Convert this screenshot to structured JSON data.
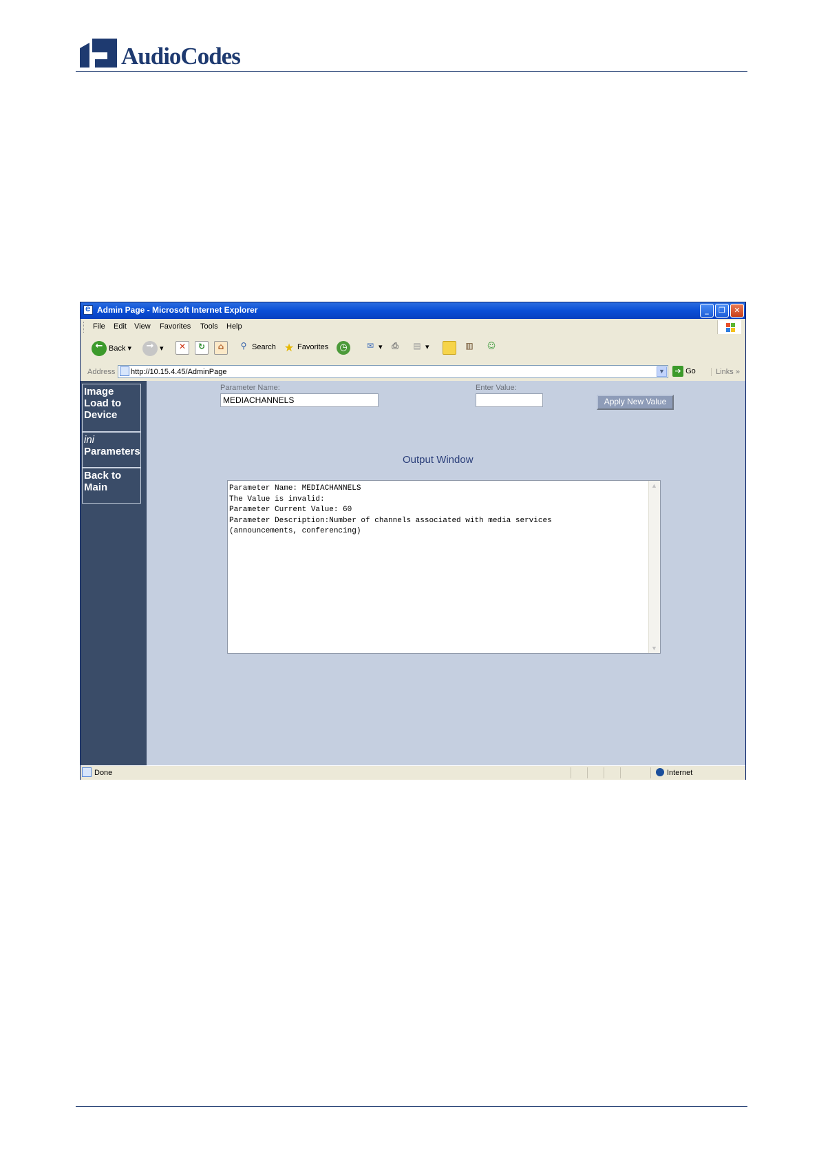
{
  "document": {
    "logo_text": "AudioCodes"
  },
  "browser": {
    "title": "Admin Page - Microsoft Internet Explorer",
    "menu": [
      "File",
      "Edit",
      "View",
      "Favorites",
      "Tools",
      "Help"
    ],
    "toolbar": {
      "back_label": "Back",
      "search_label": "Search",
      "favorites_label": "Favorites"
    },
    "address": {
      "label": "Address",
      "url": "http://10.15.4.45/AdminPage",
      "go_label": "Go",
      "links_label": "Links"
    },
    "status": {
      "text": "Done",
      "zone": "Internet"
    }
  },
  "page": {
    "nav": [
      {
        "label": "Image Load to Device"
      },
      {
        "label_italic": "ini",
        "label": "Parameters"
      },
      {
        "label": "Back to Main"
      }
    ],
    "param_name_label": "Parameter Name:",
    "param_name_value": "MEDIACHANNELS",
    "enter_value_label": "Enter Value:",
    "enter_value_value": "",
    "apply_button": "Apply New Value",
    "output_title": "Output Window",
    "output_lines": "Parameter Name: MEDIACHANNELS\nThe Value is invalid:\nParameter Current Value: 60\nParameter Description:Number of channels associated with media services\n(announcements, conferencing)"
  },
  "colors": {
    "brand": "#1e3a70",
    "nav_bg": "#3a4c68",
    "content_bg": "#c5cfe0",
    "titlebar": "#0a4fd6"
  }
}
